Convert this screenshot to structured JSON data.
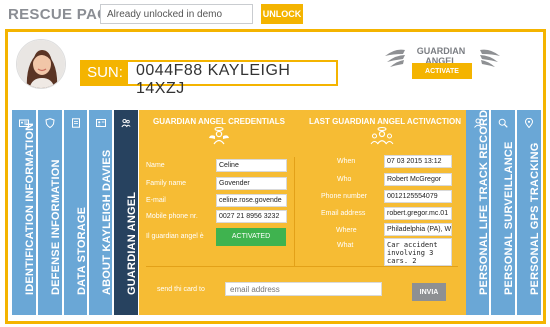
{
  "topbar": {
    "title": "RESCUE PAGE",
    "unlock_value": "Already unlocked in demo",
    "unlock_label": "UNLOCK"
  },
  "header": {
    "sun_label": "SUN:",
    "sun_value": "0044F88 KAYLEIGH 14XZJ",
    "guardian_title": "GUARDIAN ANGEL",
    "activate_label": "ACTIVATE"
  },
  "left_tabs": [
    {
      "label": "IDENTIFICATION INFORMATION",
      "icon": "id-card-icon"
    },
    {
      "label": "DEFENSE INFORMATION",
      "icon": "shield-icon"
    },
    {
      "label": "DATA STORAGE",
      "icon": "database-icon"
    },
    {
      "label": "ABOUT  KAYLEIGH DAVIES",
      "icon": "contact-card-icon"
    },
    {
      "label": "GUARDIAN ANGEL",
      "icon": "people-icon"
    }
  ],
  "right_tabs": [
    {
      "label": "PERSONAL LIFE TRACK RECORD",
      "icon": "person-icon"
    },
    {
      "label": "PERSONAL SURVEILLANCE",
      "icon": "magnifier-icon"
    },
    {
      "label": "PERSONAL GPS TRACKING",
      "icon": "gps-icon"
    }
  ],
  "credentials": {
    "title": "GUARDIAN ANGEL CREDENTIALS",
    "fields": [
      {
        "label": "Name",
        "value": "Celine"
      },
      {
        "label": "Family name",
        "value": "Govender"
      },
      {
        "label": "E-mail",
        "value": "celine.rose.govende"
      },
      {
        "label": "Mobile phone nr.",
        "value": "0027 21 8956 3232"
      }
    ],
    "status_label": "Il guardian angel è",
    "status_value": "ACTIVATED"
  },
  "activation": {
    "title": "LAST GUARDIAN ANGEL ACTIVACTION",
    "fields": [
      {
        "label": "When",
        "value": "07 03 2015 13:12"
      },
      {
        "label": "Who",
        "value": "Robert McGregor"
      },
      {
        "label": "Phone number",
        "value": "0012125554079"
      },
      {
        "label": "Email address",
        "value": "robert.gregor.mc.01"
      },
      {
        "label": "Where",
        "value": "Philadelphia (PA), Wa"
      }
    ],
    "what_label": "What",
    "what_value": "Car accident\ninvolving 3\ncars. 2"
  },
  "send": {
    "label": "send thi card to",
    "placeholder": "email address",
    "button": "INVIA"
  },
  "colors": {
    "accent": "#f4b400",
    "tab_blue": "#6aa7d6",
    "tab_dark": "#27425f",
    "activated_green": "#3fb34f"
  }
}
